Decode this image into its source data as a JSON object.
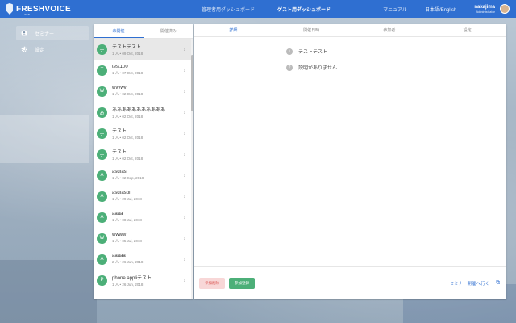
{
  "header": {
    "logo_text": "FRESHVOICE",
    "logo_sub": "WEB",
    "nav": [
      "管理者用ダッシュボード",
      "ゲスト用ダッシュボード"
    ],
    "nav_active": 1,
    "manual": "マニュアル",
    "language": "日本語/English",
    "user_name": "nakajima",
    "user_role": "Administrator"
  },
  "sidebar": {
    "items": [
      {
        "label": "セミナー",
        "icon": "seminar-icon",
        "active": true
      },
      {
        "label": "設定",
        "icon": "gear-icon",
        "active": false
      }
    ]
  },
  "list": {
    "tabs": [
      "未開催",
      "開催済み"
    ],
    "active_tab": 0,
    "items": [
      {
        "letter": "テ",
        "title": "テストテスト",
        "sub": "1 人 • 09 Oct, 2018",
        "selected": true
      },
      {
        "letter": "T",
        "title": "test100",
        "sub": "1 人 • 07 Oct, 2018"
      },
      {
        "letter": "W",
        "title": "wvvwv",
        "sub": "1 人 • 02 Oct, 2018"
      },
      {
        "letter": "あ",
        "title": "あああああああああああ",
        "sub": "1 人 • 02 Oct, 2018"
      },
      {
        "letter": "テ",
        "title": "テスト",
        "sub": "1 人 • 02 Oct, 2018"
      },
      {
        "letter": "テ",
        "title": "テスト",
        "sub": "1 人 • 02 Oct, 2018"
      },
      {
        "letter": "A",
        "title": "asdfasf",
        "sub": "1 人 • 02 Sep, 2018"
      },
      {
        "letter": "A",
        "title": "asdfasdf",
        "sub": "1 人 • 29 Jul, 2018"
      },
      {
        "letter": "A",
        "title": "aaaa",
        "sub": "1 人 • 08 Jul, 2018"
      },
      {
        "letter": "W",
        "title": "wwww",
        "sub": "1 人 • 05 Jul, 2018"
      },
      {
        "letter": "A",
        "title": "aaaaa",
        "sub": "2 人 • 26 Jun, 2018"
      },
      {
        "letter": "P",
        "title": "phone appliテスト",
        "sub": "1 人 • 26 Jun, 2018"
      }
    ]
  },
  "detail": {
    "tabs": [
      "詳細",
      "開催日時",
      "参加者",
      "設定"
    ],
    "active_tab": 0,
    "title": "テストテスト",
    "description": "説明がありません",
    "delete_label": "参加削除",
    "register_label": "参加登録",
    "room_link": "セミナー開催へ行く"
  },
  "colors": {
    "brand": "#2f6fd1",
    "green": "#4caf78",
    "danger": "#d9534f"
  }
}
